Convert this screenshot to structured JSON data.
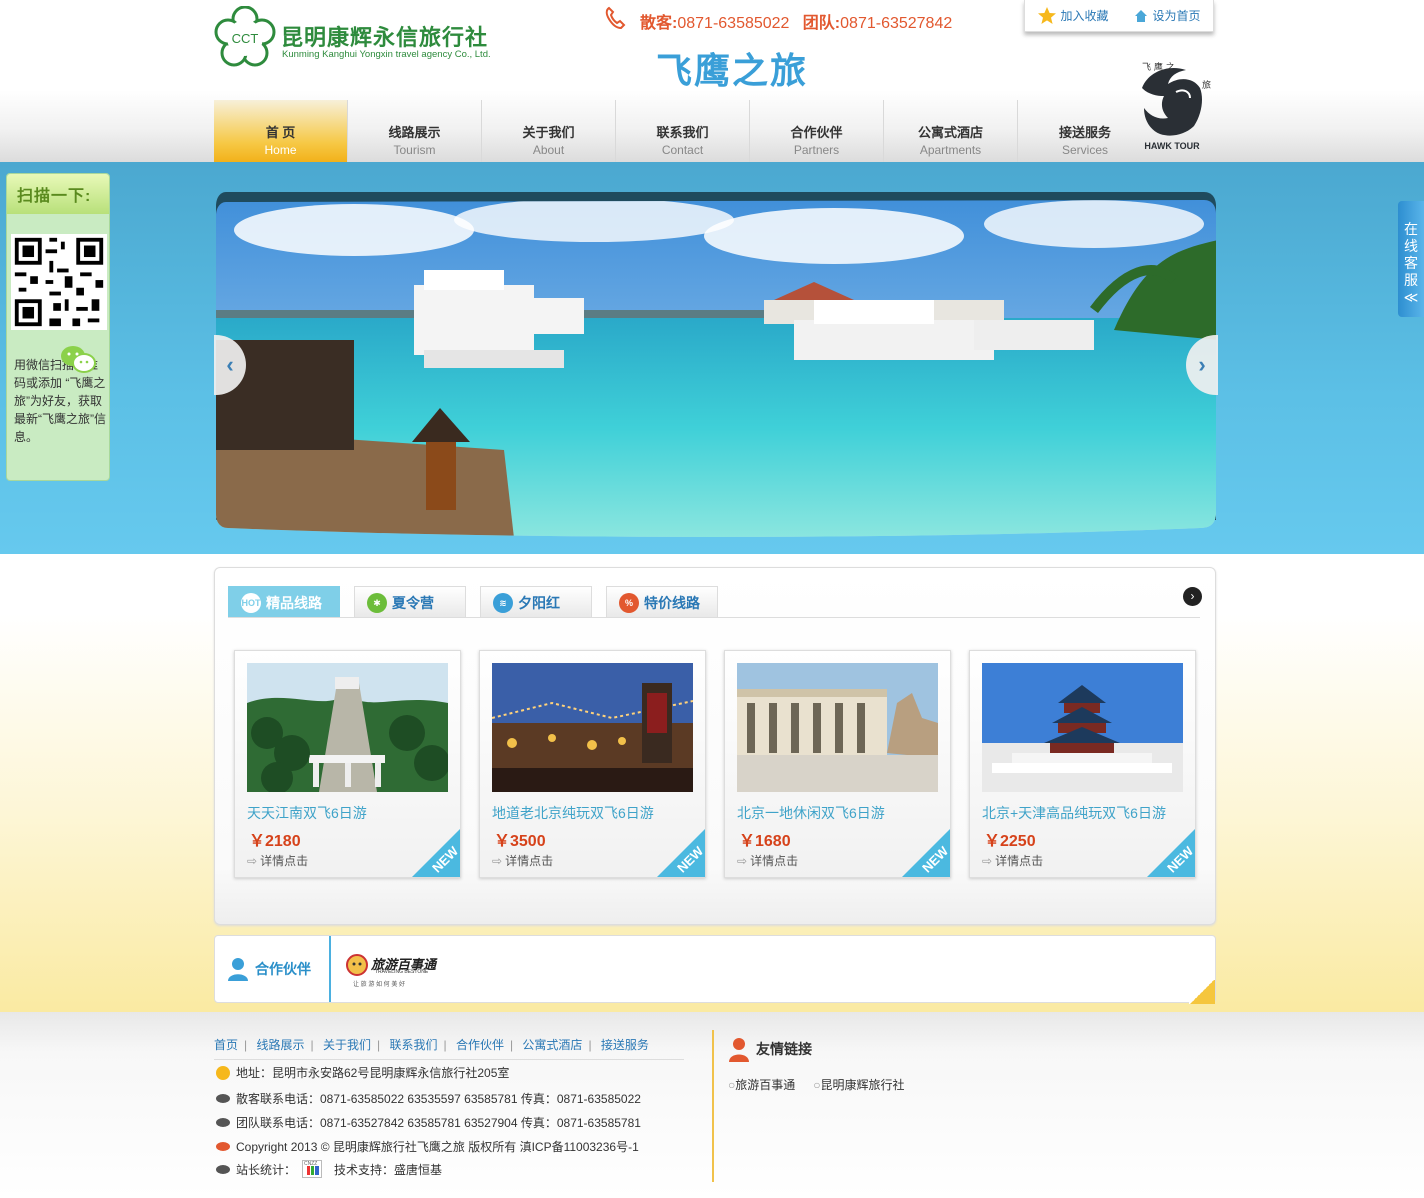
{
  "header": {
    "logo_badge": "CCT",
    "logo_cn": "昆明康辉永信旅行社",
    "logo_en": "Kunming Kanghui Yongxin travel agency Co., Ltd.",
    "phone_scatter_label": "散客:",
    "phone_scatter": "0871-63585022",
    "phone_group_label": "团队:",
    "phone_group": "0871-63527842",
    "slogan": "飞鹰之旅",
    "bookmark": "加入收藏",
    "homepage": "设为首页",
    "hawk_label": "HAWK TOUR",
    "hawk_chars": "飞鹰之旅"
  },
  "nav": [
    {
      "cn": "首 页",
      "en": "Home"
    },
    {
      "cn": "线路展示",
      "en": "Tourism"
    },
    {
      "cn": "关于我们",
      "en": "About"
    },
    {
      "cn": "联系我们",
      "en": "Contact"
    },
    {
      "cn": "合作伙伴",
      "en": "Partners"
    },
    {
      "cn": "公寓式酒店",
      "en": "Apartments"
    },
    {
      "cn": "接送服务",
      "en": "Services"
    }
  ],
  "qr": {
    "title": "扫描一下:",
    "text": "用微信扫描二维码或添加 “飞鹰之旅”为好友，获取最新“飞鹰之旅”信息。"
  },
  "service": {
    "label": "在线客服",
    "arrow": "≪"
  },
  "tabs": [
    {
      "label": "精品线路",
      "icon": "HOT"
    },
    {
      "label": "夏令营",
      "icon": "✱"
    },
    {
      "label": "夕阳红",
      "icon": "≋"
    },
    {
      "label": "特价线路",
      "icon": "%"
    }
  ],
  "products": [
    {
      "title": "天天江南双飞6日游",
      "price": "￥2180",
      "detail": "详情点击",
      "badge": "NEW"
    },
    {
      "title": "地道老北京纯玩双飞6日游",
      "price": "￥3500",
      "detail": "详情点击",
      "badge": "NEW"
    },
    {
      "title": "北京一地休闲双飞6日游",
      "price": "￥1680",
      "detail": "详情点击",
      "badge": "NEW"
    },
    {
      "title": "北京+天津高品纯玩双飞6日游",
      "price": "￥2250",
      "detail": "详情点击",
      "badge": "NEW"
    }
  ],
  "partners": {
    "title": "合作伙伴",
    "logo_text": "旅游百事通",
    "logo_en": "TRAVELING BESTONE",
    "logo_sub": "让 旅 游 如 何 美 好"
  },
  "footer": {
    "nav": [
      "首页",
      "线路展示",
      "关于我们",
      "联系我们",
      "合作伙伴",
      "公寓式酒店",
      "接送服务"
    ],
    "address": "地址：昆明市永安路62号昆明康辉永信旅行社205室",
    "scatter_phone": "散客联系电话：0871-63585022 63535597  63585781 传真：0871-63585022",
    "group_phone": "团队联系电话：0871-63527842 63585781  63527904 传真：0871-63585781",
    "copyright": "Copyright 2013 © 昆明康辉旅行社飞鹰之旅 版权所有 滇ICP备11003236号-1",
    "stats_label": "站长统计：",
    "stats_badge": "CNZZ",
    "tech": "技术支持：盛唐恒基",
    "links_title": "友情链接",
    "links": [
      "旅游百事通",
      "昆明康辉旅行社"
    ]
  },
  "colors": {
    "accent": "#3a9fd8",
    "nav_active": "#f6c844",
    "price": "#d6421a",
    "logo_green": "#2e8b3d"
  }
}
